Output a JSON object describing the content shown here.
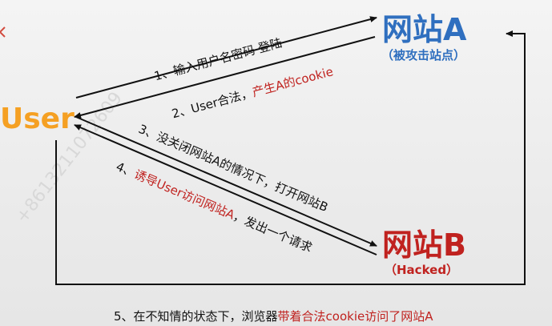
{
  "nodes": {
    "user": {
      "label": "User",
      "color": "#f5a023"
    },
    "site_a": {
      "label": "网站A",
      "sublabel": "（被攻击站点）",
      "color": "#2f6fbf"
    },
    "site_b": {
      "label": "网站B",
      "sublabel": "（Hacked）",
      "color": "#c0221f"
    }
  },
  "steps": {
    "s1": {
      "text": "1、输入用户名密码 登陆"
    },
    "s2": {
      "prefix": "2、User合法，",
      "highlight": "产生A的cookie"
    },
    "s3": {
      "text": "3、没关闭网站A的情况下，打开网站B"
    },
    "s4": {
      "prefix": "4、",
      "highlight": "诱导User访问网站A",
      "suffix": "，发出一个请求"
    },
    "s5": {
      "prefix": "5、在不知情的状态下，浏览器",
      "highlight": "带着合法cookie访问了网站A"
    }
  },
  "watermark": "+8613211072609",
  "colors": {
    "arrow": "#111111",
    "highlight": "#c0221f"
  }
}
